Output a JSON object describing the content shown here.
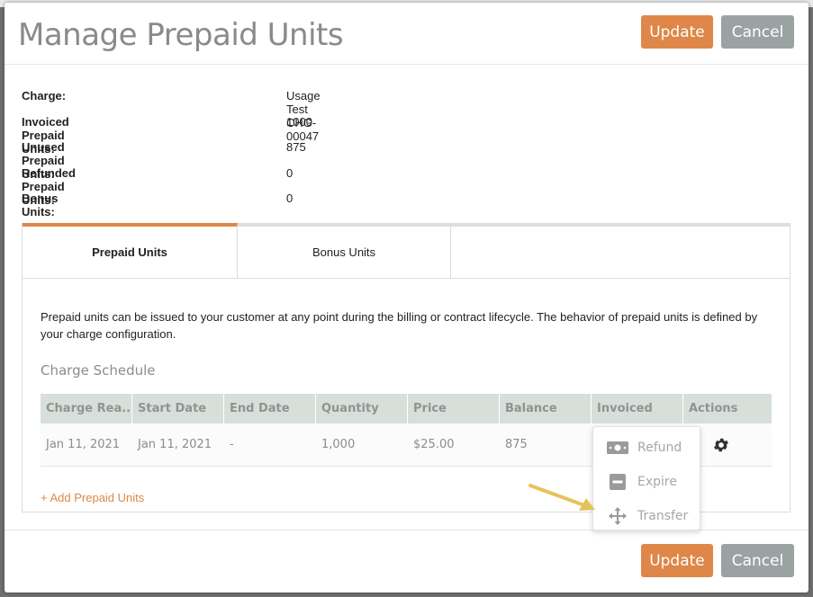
{
  "modal": {
    "title": "Manage Prepaid Units",
    "update_label": "Update",
    "cancel_label": "Cancel",
    "accent_color": "#de8748",
    "cancel_color": "#9aa3a2"
  },
  "info": [
    {
      "label": "Charge:",
      "value": "Usage Test CHG-00047"
    },
    {
      "label": "Invoiced Prepaid Units:",
      "value": "1000"
    },
    {
      "label": "Unused Prepaid Units:",
      "value": "875"
    },
    {
      "label": "Refunded Prepaid Units:",
      "value": "0"
    },
    {
      "label": "Bonus Units:",
      "value": "0"
    }
  ],
  "tabs": [
    {
      "label": "Prepaid Units",
      "active": true
    },
    {
      "label": "Bonus Units",
      "active": false
    }
  ],
  "description": "Prepaid units can be issued to your customer at any point during the billing or contract lifecycle. The behavior of prepaid units is defined by your charge configuration.",
  "schedule": {
    "title": "Charge Schedule",
    "columns": [
      "Charge Rea...",
      "Start Date",
      "End Date",
      "Quantity",
      "Price",
      "Balance",
      "Invoiced",
      "Actions"
    ],
    "rows": [
      {
        "charge_reason": "Jan 11, 2021",
        "start_date": "Jan 11, 2021",
        "end_date": "-",
        "quantity": "1,000",
        "price": "$25.00",
        "balance": "875",
        "invoiced": "",
        "actions_icon": "gear-icon"
      }
    ]
  },
  "add_link": "+ Add Prepaid Units",
  "actions_menu": [
    {
      "label": "Refund",
      "icon": "money-icon"
    },
    {
      "label": "Expire",
      "icon": "minus-box-icon"
    },
    {
      "label": "Transfer",
      "icon": "move-arrows-icon"
    }
  ]
}
